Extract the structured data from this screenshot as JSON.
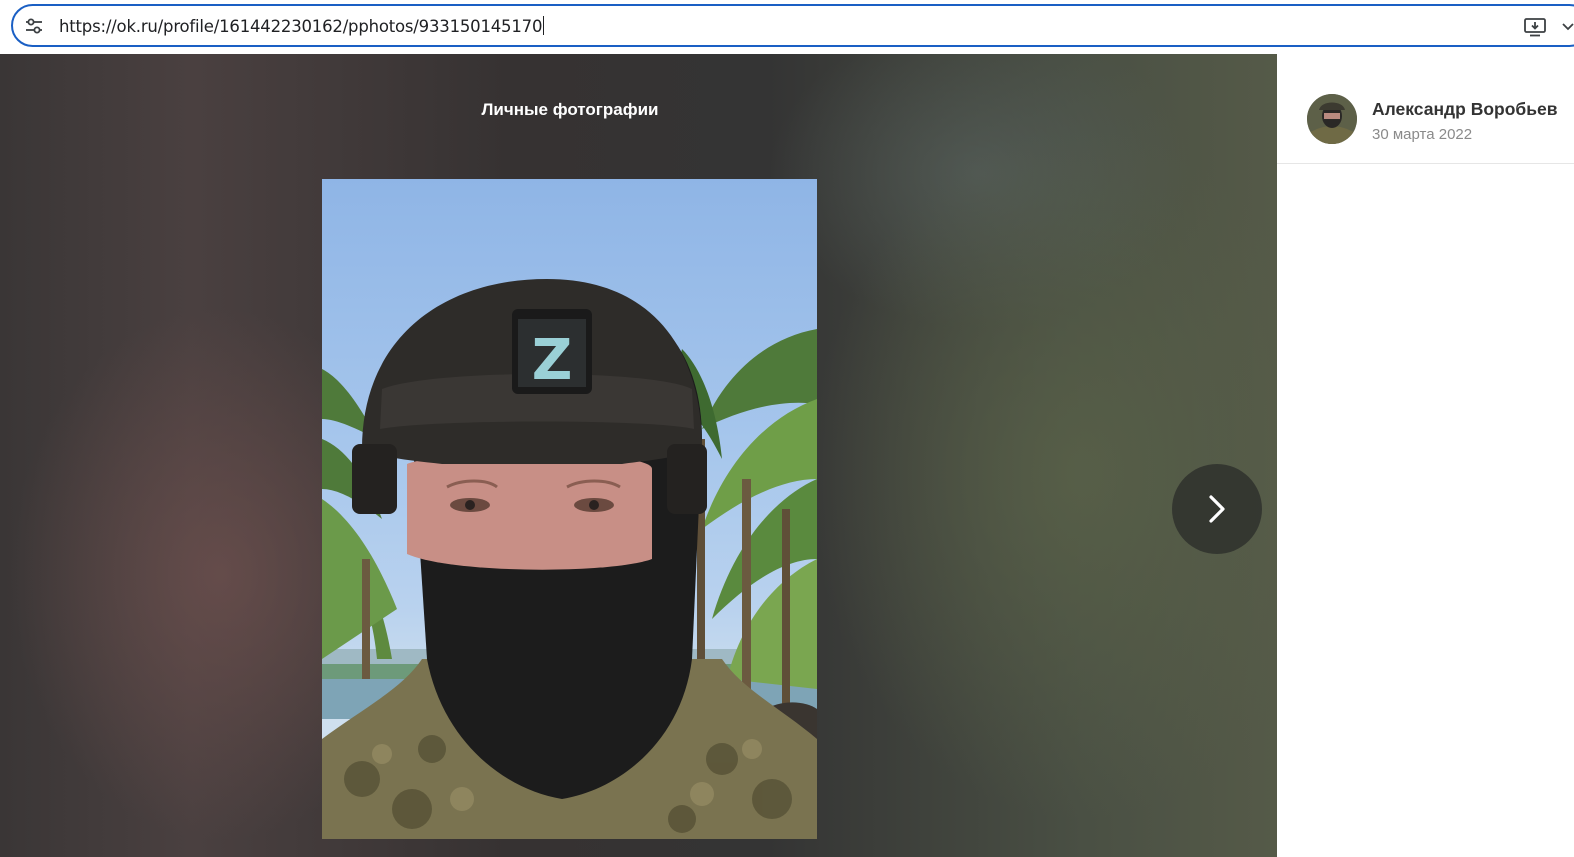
{
  "browser": {
    "url": "https://ok.ru/profile/161442230162/pphotos/933150145170",
    "icons": [
      "site-settings-icon",
      "install-app-icon",
      "chevron-down-icon"
    ]
  },
  "viewer": {
    "album_title": "Личные фотографии",
    "photo_badge": "Z",
    "next_icon": "chevron-right-icon"
  },
  "author": {
    "name": "Александр Воробьев",
    "date": "30 марта 2022"
  },
  "colors": {
    "omnibox_border": "#1a5fc4",
    "author_name": "#333333",
    "date_text": "#8a8a8a"
  }
}
